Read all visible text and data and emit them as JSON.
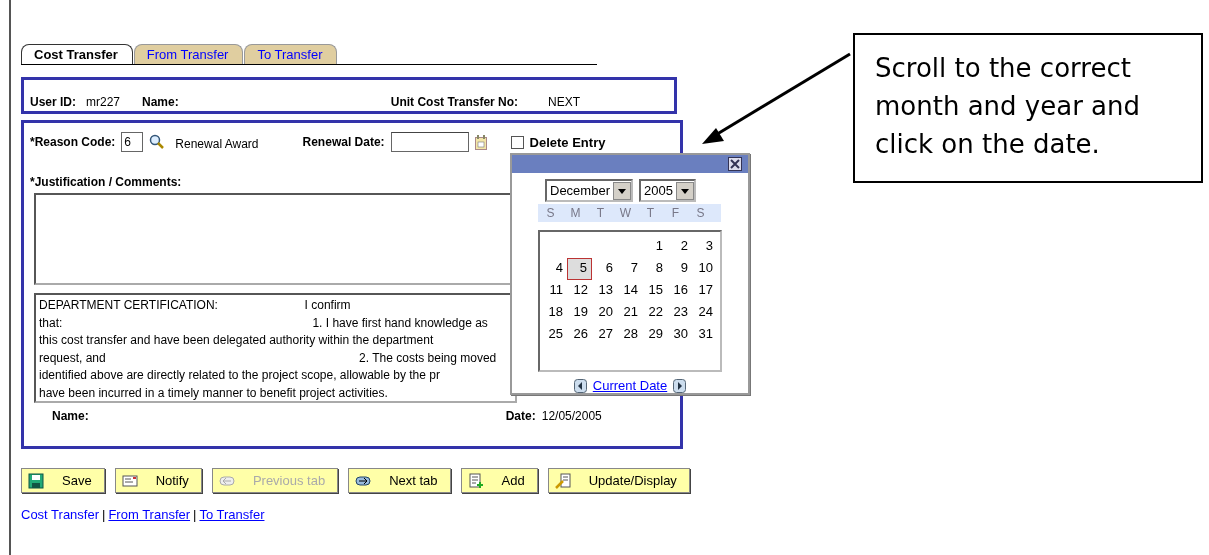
{
  "tabs": [
    {
      "label": "Cost Transfer",
      "selected": true
    },
    {
      "label": "From Transfer",
      "selected": false
    },
    {
      "label": "To Transfer",
      "selected": false
    }
  ],
  "header": {
    "user_id_label": "User ID:",
    "user_id": "mr227",
    "name_label": "Name:",
    "transfer_no_label": "Unit Cost Transfer No:",
    "transfer_no": "NEXT"
  },
  "form": {
    "reason_code_label": "*Reason Code:",
    "reason_code": "6",
    "reason_description": "Renewal Award",
    "renewal_date_label": "Renewal Date:",
    "delete_entry": {
      "label": "Delete Entry",
      "checked": false
    },
    "justification_label": "*Justification / Comments:",
    "certification_lines": [
      "DEPARTMENT CERTIFICATION:                          I confirm",
      "that:                                                                           1. I have first hand knowledge as",
      "this cost transfer and have been delegated authority within the department",
      "request, and                                                                            2. The costs being moved",
      "identified above are directly related to the project scope, allowable by the pr",
      "have been incurred in a timely manner to benefit project activities."
    ],
    "name_label": "Name:",
    "date_label": "Date:",
    "date": "12/05/2005"
  },
  "calendar": {
    "month": "December",
    "year": "2005",
    "weekdays": [
      "S",
      "M",
      "T",
      "W",
      "T",
      "F",
      "S"
    ],
    "weeks": [
      [
        {
          "label": "1",
          "selected": false
        },
        {
          "label": "2",
          "selected": false
        },
        {
          "label": "3",
          "selected": false
        }
      ],
      [
        {
          "label": "4",
          "selected": false
        },
        {
          "label": "5",
          "selected": true
        },
        {
          "label": "6",
          "selected": false
        },
        {
          "label": "7",
          "selected": false
        },
        {
          "label": "8",
          "selected": false
        },
        {
          "label": "9",
          "selected": false
        },
        {
          "label": "10",
          "selected": false
        }
      ],
      [
        {
          "label": "11",
          "selected": false
        },
        {
          "label": "12",
          "selected": false
        },
        {
          "label": "13",
          "selected": false
        },
        {
          "label": "14",
          "selected": false
        },
        {
          "label": "15",
          "selected": false
        },
        {
          "label": "16",
          "selected": false
        },
        {
          "label": "17",
          "selected": false
        }
      ],
      [
        {
          "label": "18",
          "selected": false
        },
        {
          "label": "19",
          "selected": false
        },
        {
          "label": "20",
          "selected": false
        },
        {
          "label": "21",
          "selected": false
        },
        {
          "label": "22",
          "selected": false
        },
        {
          "label": "23",
          "selected": false
        },
        {
          "label": "24",
          "selected": false
        }
      ],
      [
        {
          "label": "25",
          "selected": false
        },
        {
          "label": "26",
          "selected": false
        },
        {
          "label": "27",
          "selected": false
        },
        {
          "label": "28",
          "selected": false
        },
        {
          "label": "29",
          "selected": false
        },
        {
          "label": "30",
          "selected": false
        },
        {
          "label": "31",
          "selected": false
        }
      ]
    ],
    "current_date_link": "Current Date"
  },
  "buttons": [
    {
      "kind": "save",
      "label": "Save",
      "disabled": false
    },
    {
      "kind": "notify",
      "label": "Notify",
      "disabled": false
    },
    {
      "kind": "previous",
      "label": "Previous tab",
      "disabled": true
    },
    {
      "kind": "next",
      "label": "Next tab",
      "disabled": false
    },
    {
      "kind": "add",
      "label": "Add",
      "disabled": false
    },
    {
      "kind": "update",
      "label": "Update/Display",
      "disabled": false
    }
  ],
  "bottom_links": [
    {
      "label": "Cost Transfer",
      "underlined": false
    },
    {
      "separator": "|",
      "label": "From Transfer",
      "underlined": true
    },
    {
      "separator": "|",
      "label": "To Transfer",
      "underlined": true
    }
  ],
  "callout": {
    "text": "Scroll to the correct month and year and click on the date."
  }
}
